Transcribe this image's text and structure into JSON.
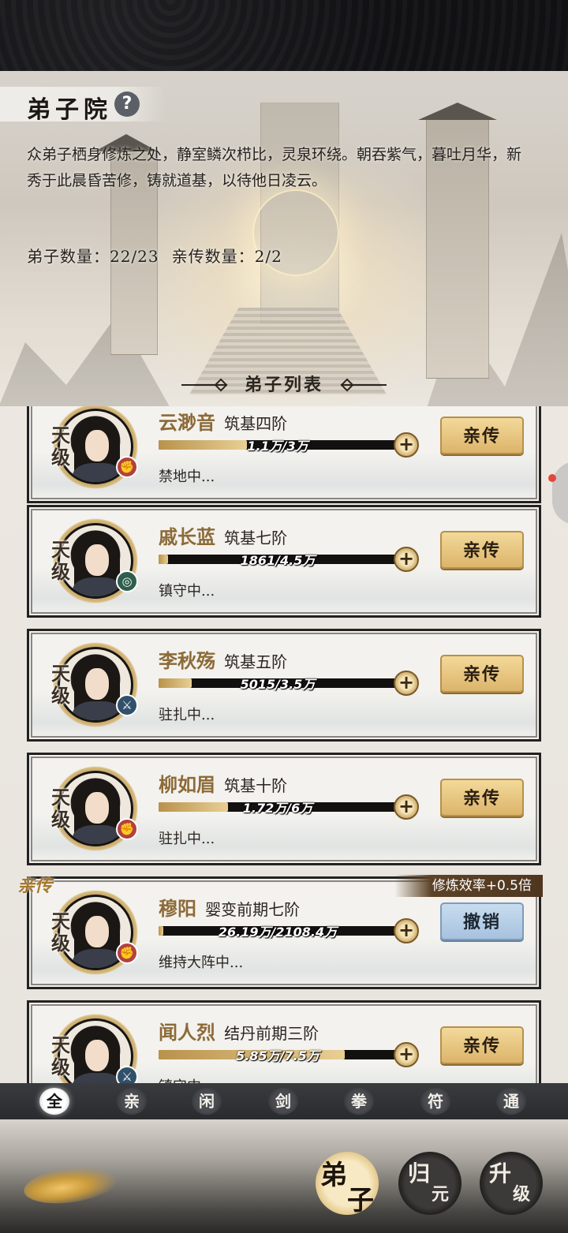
{
  "header": {
    "title": "弟子院",
    "help_icon": "?",
    "description": "众弟子栖身修炼之处，静室鳞次栉比，灵泉环绕。朝吞紫气，暮吐月华，新秀于此晨昏苦修，铸就道基，以待他日凌云。",
    "disciple_count": "弟子数量：22/23",
    "personal_count": "亲传数量：2/2",
    "list_title": "弟子列表"
  },
  "disciples": [
    {
      "grade": "天级",
      "name": "云渺音",
      "realm": "筑基四阶",
      "progress_text": "1.1万/3万",
      "progress": 0.37,
      "status": "禁地中...",
      "button": "亲传",
      "element": "red"
    },
    {
      "grade": "天级",
      "name": "戚长蓝",
      "realm": "筑基七阶",
      "progress_text": "1861/4.5万",
      "progress": 0.04,
      "status": "镇守中...",
      "button": "亲传",
      "element": "green"
    },
    {
      "grade": "天级",
      "name": "李秋殇",
      "realm": "筑基五阶",
      "progress_text": "5015/3.5万",
      "progress": 0.14,
      "status": "驻扎中...",
      "button": "亲传",
      "element": "blue"
    },
    {
      "grade": "天级",
      "name": "柳如眉",
      "realm": "筑基十阶",
      "progress_text": "1.72万/6万",
      "progress": 0.29,
      "status": "驻扎中...",
      "button": "亲传",
      "element": "red"
    },
    {
      "grade": "天级",
      "name": "穆阳",
      "realm": "婴变前期七阶",
      "progress_text": "26.19万/2108.4万",
      "progress": 0.01,
      "status": "维持大阵中...",
      "button": "撤销",
      "element": "red",
      "tag": "亲传",
      "bonus": "修炼效率+0.5倍"
    },
    {
      "grade": "天级",
      "name": "闻人烈",
      "realm": "结丹前期三阶",
      "progress_text": "5.85万/7.5万",
      "progress": 0.78,
      "status": "镇守中...",
      "button": "亲传",
      "element": "blue"
    }
  ],
  "filters": [
    "全",
    "亲",
    "闲",
    "剑",
    "拳",
    "符",
    "通"
  ],
  "active_filter": 0,
  "nav": [
    {
      "a": "弟",
      "b": "子",
      "active": true
    },
    {
      "a": "归",
      "b": "元",
      "active": false
    },
    {
      "a": "升",
      "b": "级",
      "active": false
    }
  ],
  "colors": {
    "accent_gold": "#dcb46a",
    "revoke_blue": "#a6c2df",
    "name_gold": "#8c6a38"
  }
}
